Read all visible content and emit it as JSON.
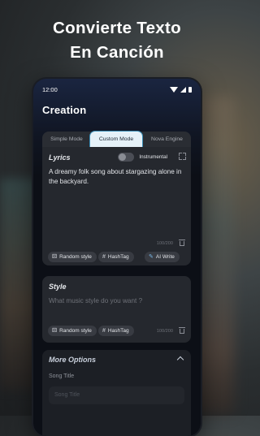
{
  "headline": {
    "line1": "Convierte Texto",
    "line2": "En Canción"
  },
  "status": {
    "time": "12:00"
  },
  "app": {
    "title": "Creation"
  },
  "tabs": [
    {
      "label": "Simple Mode"
    },
    {
      "label": "Custom Mode",
      "active": true
    },
    {
      "label": "Nova Engine"
    }
  ],
  "lyrics": {
    "label": "Lyrics",
    "instrumental_label": "Instrumental",
    "instrumental_on": false,
    "text": "A dreamy folk song about stargazing alone in the backyard.",
    "counter": "100/200",
    "chips": {
      "random": "Random style",
      "hashtag": "HashTag",
      "ai": "AI Write"
    }
  },
  "style": {
    "label": "Style",
    "placeholder": "What music style do you want ?",
    "counter": "100/200",
    "chips": {
      "random": "Random style",
      "hashtag": "HashTag"
    }
  },
  "more": {
    "title": "More Options",
    "song_title_label": "Song Title",
    "song_title_placeholder": "Song Title"
  },
  "colors": {
    "accent": "#3c8fb8",
    "active_tab_bg": "#e5f1f8",
    "card_bg": "#25282e",
    "screen_bg": "#0c0f16"
  },
  "icons": [
    "wifi-icon",
    "signal-icon",
    "battery-icon",
    "expand-icon",
    "trash-icon",
    "dice-icon",
    "hashtag-icon",
    "ai-write-icon",
    "chevron-up-icon"
  ]
}
